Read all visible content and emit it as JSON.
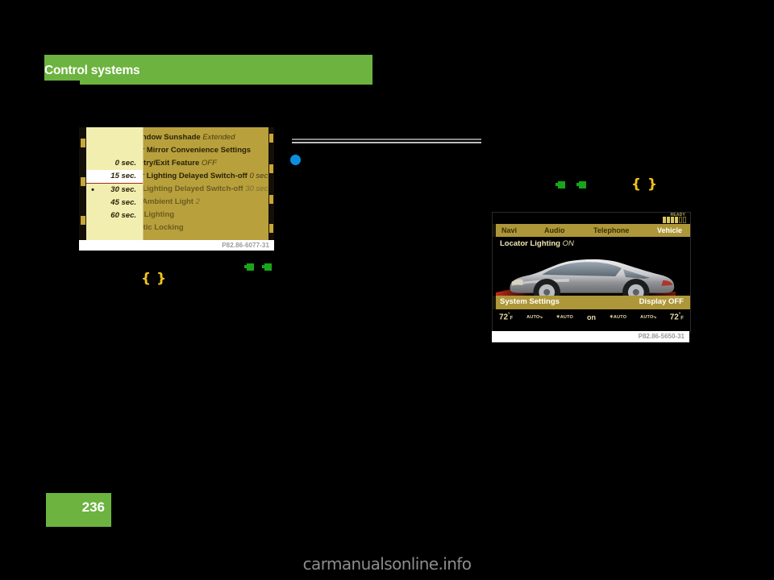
{
  "document": {
    "chapter_title": "Control systems",
    "page_number": "236",
    "watermark": "carmanualsonline.info"
  },
  "figure_menu": {
    "caption": "P82.86-6077-31",
    "popup_options": [
      {
        "label": "0 sec.",
        "selected": false,
        "bullet": false
      },
      {
        "label": "15 sec.",
        "selected": true,
        "bullet": false
      },
      {
        "label": "30 sec.",
        "selected": false,
        "bullet": true
      },
      {
        "label": "45 sec.",
        "selected": false,
        "bullet": false
      },
      {
        "label": "60 sec.",
        "selected": false,
        "bullet": false
      }
    ],
    "menu_rows": [
      {
        "label": "r Window Sunshade",
        "value": "Extended",
        "dim": false
      },
      {
        "label": "erior Mirror Convenience Settings",
        "value": "",
        "dim": false
      },
      {
        "label": "y Entry/Exit Feature",
        "value": "OFF",
        "dim": false
      },
      {
        "label": "erior Lighting Delayed Switch-off",
        "value": "0 sec.",
        "dim": false
      },
      {
        "label": "rior Lighting Delayed Switch-off",
        "value": "30 sec.",
        "dim": true
      },
      {
        "label": "rior Ambient Light",
        "value": "2",
        "dim": true
      },
      {
        "label": "ator Lighting",
        "value": "",
        "dim": true
      },
      {
        "label": "omatic Locking",
        "value": "",
        "dim": true
      }
    ]
  },
  "figure_display": {
    "caption": "P82.86-5650-31",
    "status": {
      "ready_label": "READY",
      "signal_bars_on": 4,
      "signal_bars_off": 2
    },
    "tabs": [
      {
        "label": "Navi",
        "active": false
      },
      {
        "label": "Audio",
        "active": false
      },
      {
        "label": "Telephone",
        "active": false
      },
      {
        "label": "Vehicle",
        "active": true
      }
    ],
    "headline_label": "Locator Lighting",
    "headline_value": "ON",
    "bottom_left_label": "System Settings",
    "bottom_right_label": "Display OFF",
    "climate": {
      "left_temp": "72",
      "left_degree": "°",
      "left_unit": "F",
      "left_auto": "AUTO",
      "center_auto_left": "AUTO",
      "center_state": "on",
      "center_auto_right": "AUTO",
      "right_auto": "AUTO",
      "right_temp": "72",
      "right_degree": "°",
      "right_unit": "F"
    }
  },
  "theme": {
    "accent_green": "#6cb33f",
    "marker_green": "#19a519",
    "marker_yellow": "#f0c419",
    "dot_blue": "#0b8fde",
    "screen_gold": "#ae9738",
    "menu_gold": "#b8a03c",
    "popup_cream": "#f2eeb0"
  }
}
